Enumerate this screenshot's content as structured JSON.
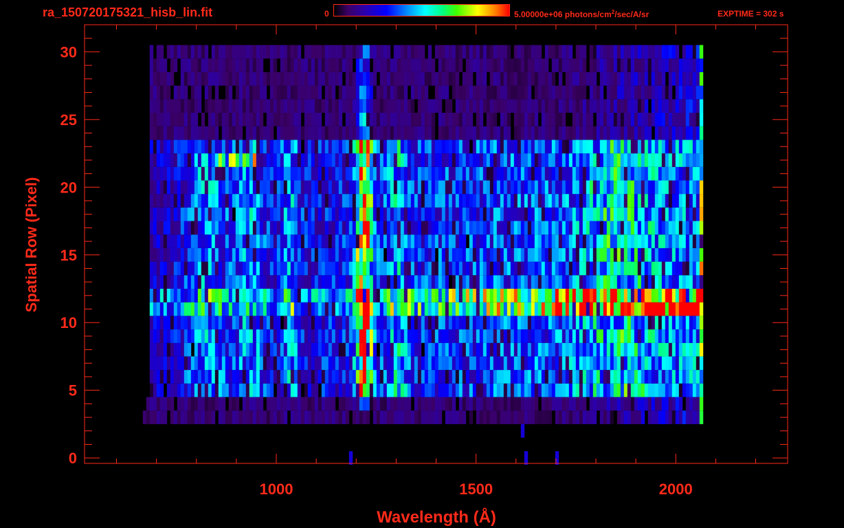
{
  "header": {
    "file_title": "ra_150720175321_hisb_lin.fit",
    "colorbar_min": "0",
    "colorbar_max_value": "5.00000e+06 photons/cm",
    "colorbar_max_sup": "2",
    "colorbar_max_units": "/sec/A/sr",
    "exptime": "EXPTIME = 302 s"
  },
  "colors": {
    "axis": "#ff2a1a",
    "background": "#000000"
  },
  "chart_data": {
    "type": "heatmap",
    "title": "ra_150720175321_hisb_lin.fit",
    "xlabel": "Wavelength (Å)",
    "ylabel": "Spatial Row (Pixel)",
    "xlim": [
      520,
      2280
    ],
    "ylim": [
      -0.4,
      32
    ],
    "xticks": [
      1000,
      1500,
      2000
    ],
    "yticks": [
      0,
      5,
      10,
      15,
      20,
      25,
      30
    ],
    "colorscale": [
      "#000000",
      "#3b0066",
      "#2a00b0",
      "#0000ff",
      "#0090ff",
      "#00ffff",
      "#00ff80",
      "#40ff00",
      "#ffff00",
      "#ff8000",
      "#ff0000"
    ],
    "colorbar_range": [
      0,
      5000000
    ],
    "colorbar_units": "photons/cm^2/sec/A/sr",
    "features": {
      "rows_with_signal": [
        3,
        30
      ],
      "wavelength_coverage": [
        680,
        2070
      ],
      "bright_emission_line_wavelength": 1216,
      "bright_continuum_rows": [
        11,
        12
      ],
      "detector_edge_wavelength": 2065
    }
  }
}
